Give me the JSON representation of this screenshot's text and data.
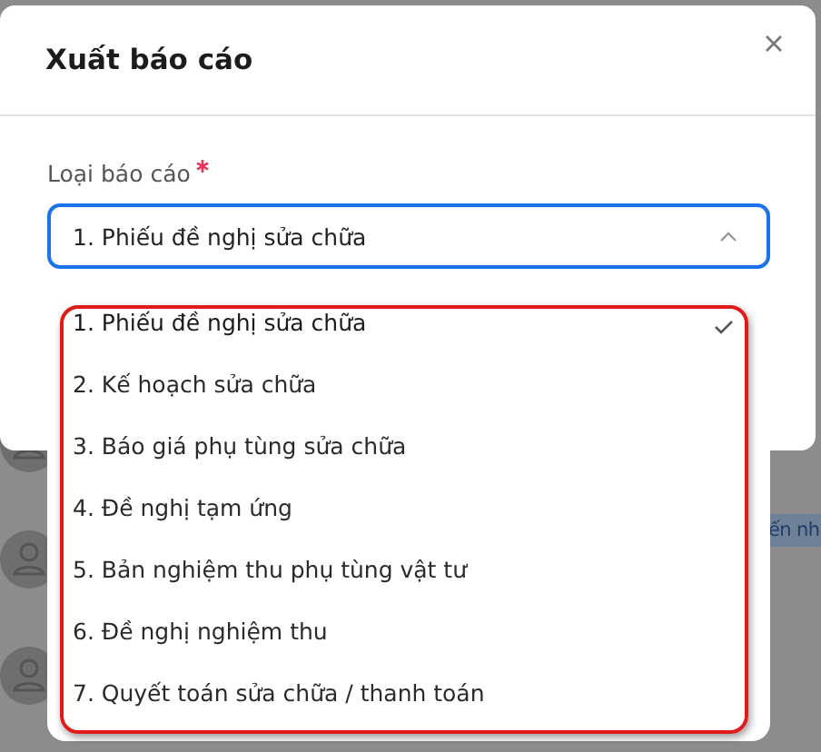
{
  "background": {
    "chip_text": "ến nh"
  },
  "dialog": {
    "title": "Xuất báo cáo",
    "field": {
      "label": "Loại báo cáo",
      "required": true,
      "value": "1. Phiếu đề nghị sửa chữa",
      "expanded": true
    }
  },
  "dropdown": {
    "highlighted": true,
    "options": [
      {
        "label": "1. Phiếu đề nghị sửa chữa",
        "selected": true
      },
      {
        "label": "2. Kế hoạch sửa chữa",
        "selected": false
      },
      {
        "label": "3. Báo giá phụ tùng sửa chữa",
        "selected": false
      },
      {
        "label": "4. Đề nghị tạm ứng",
        "selected": false
      },
      {
        "label": "5. Bản nghiệm thu phụ tùng vật tư",
        "selected": false
      },
      {
        "label": "6. Đề nghị nghiệm thu",
        "selected": false
      },
      {
        "label": "7. Quyết toán sửa chữa / thanh toán",
        "selected": false
      }
    ]
  }
}
